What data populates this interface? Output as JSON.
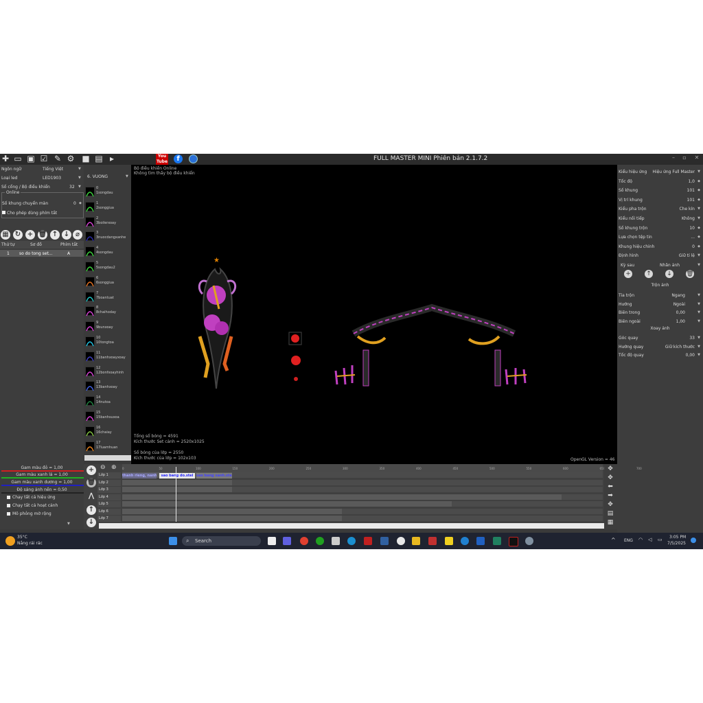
{
  "window": {
    "title": "FULL MASTER MINI Phiên bản 2.1.7.2",
    "youtube_label": "You Tube",
    "fb_label": "f"
  },
  "left": {
    "rows": [
      {
        "key": "Ngôn ngữ",
        "value": "Tiếng Việt"
      },
      {
        "key": "Loại led",
        "value": "LED1903"
      },
      {
        "key": "Số cổng / Bộ điều khiển",
        "value": "32"
      }
    ],
    "online_label": "Online",
    "chuyen_man_label": "Số khung chuyển màn",
    "chuyen_man_value": "0",
    "phim_tat_label": "Cho phép dùng phím tắt",
    "table_headers": [
      "Thứ tự",
      "Sơ đồ",
      "Phím tắt"
    ],
    "table_row": {
      "index": "1",
      "name": "so do tong set...",
      "key": "A"
    }
  },
  "effects": {
    "group_label": "6. VUONG",
    "items": [
      {
        "num": "0",
        "label": "1songdau",
        "color": "#3ccf3c"
      },
      {
        "num": "1",
        "label": "2songgiua",
        "color": "#3ccf3c"
      },
      {
        "num": "2",
        "label": "3boilerxoay",
        "color": "#d040d0"
      },
      {
        "num": "3",
        "label": "3nuocdangxanhe",
        "color": "#2a2aa0"
      },
      {
        "num": "4",
        "label": "4songdau",
        "color": "#3ccf3c"
      },
      {
        "num": "5",
        "label": "5songdau2",
        "color": "#3ccf3c"
      },
      {
        "num": "6",
        "label": "6songgiua",
        "color": "#e07020"
      },
      {
        "num": "7",
        "label": "7boantuat",
        "color": "#20c0c0"
      },
      {
        "num": "8",
        "label": "8chaihoday",
        "color": "#d040d0"
      },
      {
        "num": "9",
        "label": "9bunxoay",
        "color": "#d040d0"
      },
      {
        "num": "10",
        "label": "10tongtoa",
        "color": "#20c0e0"
      },
      {
        "num": "11",
        "label": "11banhxoayxoay",
        "color": "#4040c0"
      },
      {
        "num": "12",
        "label": "12bonfxoayhinh",
        "color": "#d040d0"
      },
      {
        "num": "13",
        "label": "13banhxoay",
        "color": "#4060e0"
      },
      {
        "num": "14",
        "label": "14nutoa",
        "color": "#208040"
      },
      {
        "num": "15",
        "label": "15banhsuxoa",
        "color": "#d040d0"
      },
      {
        "num": "16",
        "label": "16chaiay",
        "color": "#80c040"
      },
      {
        "num": "17",
        "label": "17luamhuan",
        "color": "#e08020"
      }
    ]
  },
  "canvas": {
    "status_line1": "Bộ điều khiển Online",
    "status_line2": "Không tìm thấy bộ điều khiển",
    "total_points": "Tổng số bóng = 4591",
    "canvas_size": "Kích thước Set cảnh = 2520x1025",
    "layer_points": "Số bóng của lớp = 2550",
    "layer_size": "Kích thước của lớp = 102x103",
    "opengl": "OpenGL Version = 46"
  },
  "right": {
    "rows": [
      {
        "key": "Kiểu hiệu ứng",
        "value": "Hiệu ứng Full Master"
      },
      {
        "key": "Tốc độ",
        "value": "1,0"
      },
      {
        "key": "Số khung",
        "value": "101"
      },
      {
        "key": "Vị trí khung",
        "value": "101"
      },
      {
        "key": "Kiểu pha trộn",
        "value": "Che kín"
      },
      {
        "key": "Kiểu nối tiếp",
        "value": "Không"
      },
      {
        "key": "Số khung trộn",
        "value": "10"
      },
      {
        "key": "Lựa chọn tệp tin",
        "value": "..."
      },
      {
        "key": "Khung hiệu chỉnh",
        "value": "0"
      },
      {
        "key": "Định hình",
        "value": "Giữ tỉ lệ"
      }
    ],
    "ky_sau_label": "Kỳ sau",
    "ky_sau_value": "Nhân ảnh",
    "tron_anh": "Trộn ảnh",
    "tron_rows": [
      {
        "key": "Tia trộn",
        "value": "Ngang"
      },
      {
        "key": "Hướng",
        "value": "Ngoài"
      },
      {
        "key": "Biên trong",
        "value": "0,00"
      },
      {
        "key": "Biên ngoài",
        "value": "1,00"
      }
    ],
    "xoay_anh": "Xoay ảnh",
    "xoay_rows": [
      {
        "key": "Góc quay",
        "value": "33"
      },
      {
        "key": "Hướng quay",
        "value": "Giữ kích thước"
      },
      {
        "key": "Tốc độ quay",
        "value": "0,00"
      }
    ]
  },
  "gamma": {
    "red": "Gam màu đỏ = 1,00",
    "green": "Gam màu xanh lá = 1,00",
    "blue": "Gam màu xanh dương = 1,00",
    "bright": "Độ sáng ảnh nền = 0,50",
    "checks": [
      "Chạy tất cả hiệu ứng",
      "Chạy tất cả hoạt cảnh",
      "Mô phỏng mờ rộng"
    ]
  },
  "timeline": {
    "layers": [
      "Lớp 1",
      "Lớp 2",
      "Lớp 3",
      "Lớp 4",
      "Lớp 5",
      "Lớp 6",
      "Lớp 7"
    ],
    "ticks": [
      "0",
      "50",
      "100",
      "150",
      "200",
      "250",
      "300",
      "350",
      "400",
      "450",
      "500",
      "550",
      "600",
      "650",
      "700"
    ],
    "clips": [
      "thanh rieng, nanh thu",
      "sao bang do.stel",
      "sao bang xanh.stel"
    ]
  },
  "taskbar": {
    "temp": "35°C",
    "weather": "Nắng rải rác",
    "search": "Search",
    "lang": "ENG",
    "time": "3:05 PM",
    "date": "7/5/2025"
  }
}
